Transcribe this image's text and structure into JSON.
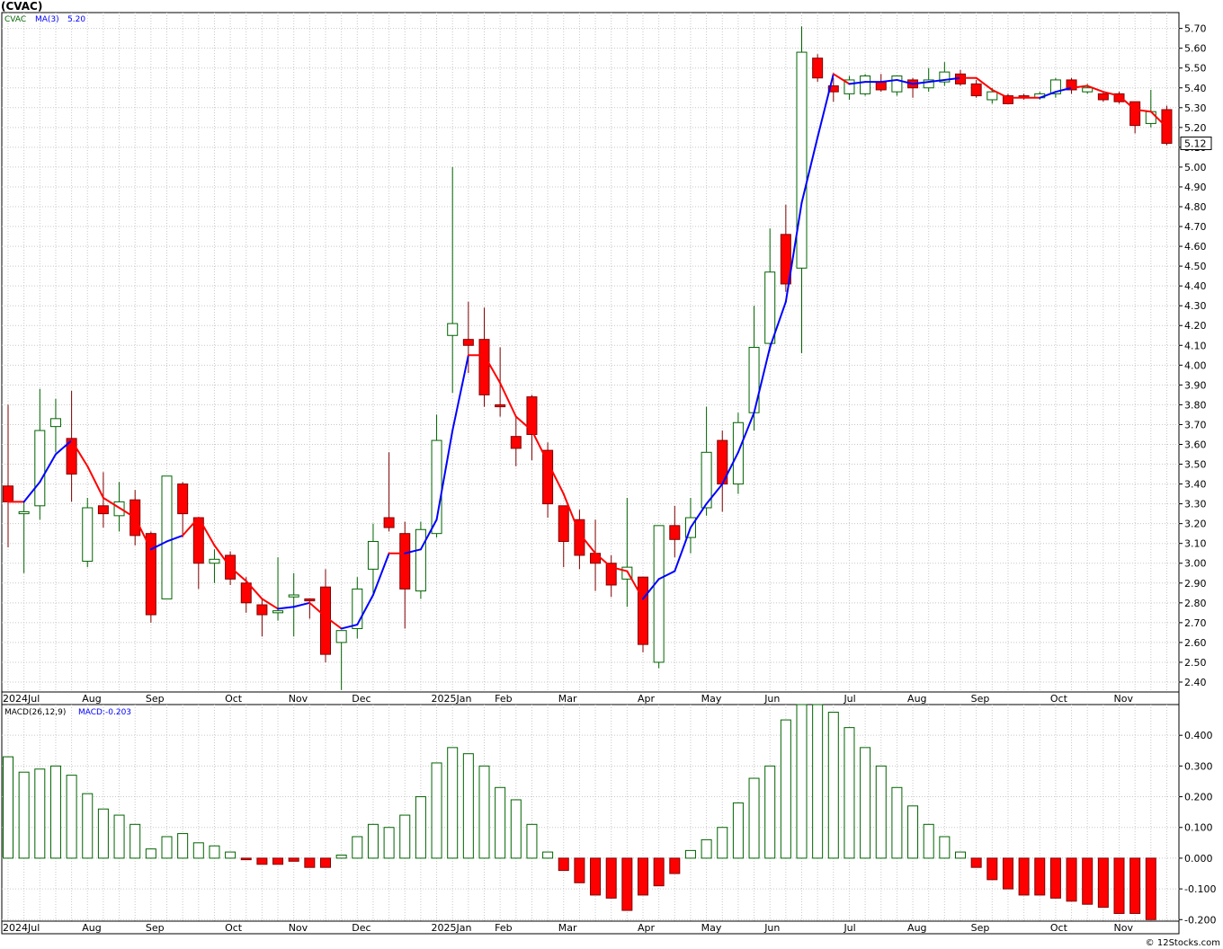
{
  "chart_data": [
    {
      "type": "candlestick",
      "title": "(CVAC)",
      "legend": {
        "symbol": "CVAC",
        "ma_label": "MA(3)",
        "ma_value": "5.20"
      },
      "last_price_tag": "5.12",
      "ylim": [
        2.35,
        5.78
      ],
      "y_ticks": [
        "5.70",
        "5.60",
        "5.50",
        "5.40",
        "5.30",
        "5.20",
        "5.10",
        "5.00",
        "4.90",
        "4.80",
        "4.70",
        "4.60",
        "4.50",
        "4.40",
        "4.30",
        "4.20",
        "4.10",
        "4.00",
        "3.90",
        "3.80",
        "3.70",
        "3.60",
        "3.50",
        "3.40",
        "3.30",
        "3.20",
        "3.10",
        "3.00",
        "2.90",
        "2.80",
        "2.70",
        "2.60",
        "2.50",
        "2.40"
      ],
      "x_labels": [
        {
          "label": "2024Jul",
          "index": 0
        },
        {
          "label": "Aug",
          "index": 5
        },
        {
          "label": "Sep",
          "index": 9
        },
        {
          "label": "Oct",
          "index": 14
        },
        {
          "label": "Nov",
          "index": 18
        },
        {
          "label": "Dec",
          "index": 22
        },
        {
          "label": "2025Jan",
          "index": 27
        },
        {
          "label": "Feb",
          "index": 31
        },
        {
          "label": "Mar",
          "index": 35
        },
        {
          "label": "Apr",
          "index": 40
        },
        {
          "label": "May",
          "index": 44
        },
        {
          "label": "Jun",
          "index": 48
        },
        {
          "label": "Jul",
          "index": 53
        },
        {
          "label": "Aug",
          "index": 57
        },
        {
          "label": "Sep",
          "index": 61
        },
        {
          "label": "Oct",
          "index": 66
        },
        {
          "label": "Nov",
          "index": 70
        }
      ],
      "candles": [
        {
          "o": 3.39,
          "h": 3.8,
          "l": 3.08,
          "c": 3.31
        },
        {
          "o": 3.25,
          "h": 3.31,
          "l": 2.95,
          "c": 3.26
        },
        {
          "o": 3.29,
          "h": 3.88,
          "l": 3.22,
          "c": 3.67
        },
        {
          "o": 3.69,
          "h": 3.83,
          "l": 3.56,
          "c": 3.73
        },
        {
          "o": 3.63,
          "h": 3.87,
          "l": 3.31,
          "c": 3.45
        },
        {
          "o": 3.01,
          "h": 3.33,
          "l": 2.98,
          "c": 3.28
        },
        {
          "o": 3.29,
          "h": 3.46,
          "l": 3.18,
          "c": 3.25
        },
        {
          "o": 3.24,
          "h": 3.41,
          "l": 3.16,
          "c": 3.31
        },
        {
          "o": 3.32,
          "h": 3.37,
          "l": 3.09,
          "c": 3.14
        },
        {
          "o": 3.15,
          "h": 3.16,
          "l": 2.7,
          "c": 2.74
        },
        {
          "o": 2.82,
          "h": 3.44,
          "l": 2.82,
          "c": 3.44
        },
        {
          "o": 3.4,
          "h": 3.41,
          "l": 3.13,
          "c": 3.25
        },
        {
          "o": 3.23,
          "h": 3.23,
          "l": 2.87,
          "c": 3.0
        },
        {
          "o": 3.0,
          "h": 3.07,
          "l": 2.9,
          "c": 3.02
        },
        {
          "o": 3.04,
          "h": 3.06,
          "l": 2.89,
          "c": 2.92
        },
        {
          "o": 2.9,
          "h": 2.93,
          "l": 2.75,
          "c": 2.8
        },
        {
          "o": 2.79,
          "h": 2.82,
          "l": 2.63,
          "c": 2.74
        },
        {
          "o": 2.75,
          "h": 3.03,
          "l": 2.71,
          "c": 2.76
        },
        {
          "o": 2.83,
          "h": 2.95,
          "l": 2.63,
          "c": 2.84
        },
        {
          "o": 2.82,
          "h": 2.82,
          "l": 2.72,
          "c": 2.81
        },
        {
          "o": 2.88,
          "h": 2.97,
          "l": 2.5,
          "c": 2.54
        },
        {
          "o": 2.6,
          "h": 2.65,
          "l": 2.36,
          "c": 2.66
        },
        {
          "o": 2.67,
          "h": 2.93,
          "l": 2.62,
          "c": 2.87
        },
        {
          "o": 2.97,
          "h": 3.2,
          "l": 2.85,
          "c": 3.11
        },
        {
          "o": 3.23,
          "h": 3.56,
          "l": 3.16,
          "c": 3.18
        },
        {
          "o": 3.15,
          "h": 3.21,
          "l": 2.67,
          "c": 2.87
        },
        {
          "o": 2.86,
          "h": 3.21,
          "l": 2.82,
          "c": 3.17
        },
        {
          "o": 3.15,
          "h": 3.75,
          "l": 3.13,
          "c": 3.62
        },
        {
          "o": 4.15,
          "h": 5.0,
          "l": 3.86,
          "c": 4.21
        },
        {
          "o": 4.13,
          "h": 4.32,
          "l": 3.96,
          "c": 4.1
        },
        {
          "o": 4.13,
          "h": 4.29,
          "l": 3.79,
          "c": 3.85
        },
        {
          "o": 3.8,
          "h": 4.09,
          "l": 3.74,
          "c": 3.79
        },
        {
          "o": 3.64,
          "h": 3.74,
          "l": 3.49,
          "c": 3.58
        },
        {
          "o": 3.84,
          "h": 3.85,
          "l": 3.52,
          "c": 3.65
        },
        {
          "o": 3.57,
          "h": 3.61,
          "l": 3.23,
          "c": 3.3
        },
        {
          "o": 3.29,
          "h": 3.28,
          "l": 2.98,
          "c": 3.11
        },
        {
          "o": 3.22,
          "h": 3.27,
          "l": 2.97,
          "c": 3.04
        },
        {
          "o": 3.05,
          "h": 3.22,
          "l": 2.86,
          "c": 3.0
        },
        {
          "o": 3.0,
          "h": 3.04,
          "l": 2.83,
          "c": 2.89
        },
        {
          "o": 2.92,
          "h": 3.33,
          "l": 2.78,
          "c": 2.98
        },
        {
          "o": 2.93,
          "h": 2.93,
          "l": 2.55,
          "c": 2.59
        },
        {
          "o": 2.5,
          "h": 3.19,
          "l": 2.47,
          "c": 3.19
        },
        {
          "o": 3.19,
          "h": 3.29,
          "l": 3.03,
          "c": 3.12
        },
        {
          "o": 3.13,
          "h": 3.33,
          "l": 3.05,
          "c": 3.23
        },
        {
          "o": 3.28,
          "h": 3.79,
          "l": 3.24,
          "c": 3.56
        },
        {
          "o": 3.62,
          "h": 3.67,
          "l": 3.26,
          "c": 3.4
        },
        {
          "o": 3.4,
          "h": 3.76,
          "l": 3.35,
          "c": 3.71
        },
        {
          "o": 3.76,
          "h": 4.3,
          "l": 3.67,
          "c": 4.09
        },
        {
          "o": 4.11,
          "h": 4.69,
          "l": 4.07,
          "c": 4.47
        },
        {
          "o": 4.66,
          "h": 4.81,
          "l": 4.37,
          "c": 4.41
        },
        {
          "o": 4.49,
          "h": 5.71,
          "l": 4.06,
          "c": 5.58
        },
        {
          "o": 5.55,
          "h": 5.57,
          "l": 5.43,
          "c": 5.45
        },
        {
          "o": 5.41,
          "h": 5.45,
          "l": 5.33,
          "c": 5.38
        },
        {
          "o": 5.37,
          "h": 5.46,
          "l": 5.34,
          "c": 5.44
        },
        {
          "o": 5.37,
          "h": 5.47,
          "l": 5.36,
          "c": 5.46
        },
        {
          "o": 5.43,
          "h": 5.47,
          "l": 5.38,
          "c": 5.39
        },
        {
          "o": 5.38,
          "h": 5.46,
          "l": 5.36,
          "c": 5.46
        },
        {
          "o": 5.44,
          "h": 5.45,
          "l": 5.35,
          "c": 5.4
        },
        {
          "o": 5.4,
          "h": 5.5,
          "l": 5.38,
          "c": 5.44
        },
        {
          "o": 5.43,
          "h": 5.53,
          "l": 5.41,
          "c": 5.48
        },
        {
          "o": 5.47,
          "h": 5.49,
          "l": 5.41,
          "c": 5.42
        },
        {
          "o": 5.42,
          "h": 5.44,
          "l": 5.35,
          "c": 5.36
        },
        {
          "o": 5.34,
          "h": 5.4,
          "l": 5.32,
          "c": 5.38
        },
        {
          "o": 5.36,
          "h": 5.37,
          "l": 5.32,
          "c": 5.32
        },
        {
          "o": 5.36,
          "h": 5.37,
          "l": 5.34,
          "c": 5.35
        },
        {
          "o": 5.35,
          "h": 5.38,
          "l": 5.34,
          "c": 5.37
        },
        {
          "o": 5.37,
          "h": 5.45,
          "l": 5.35,
          "c": 5.44
        },
        {
          "o": 5.44,
          "h": 5.45,
          "l": 5.37,
          "c": 5.39
        },
        {
          "o": 5.38,
          "h": 5.42,
          "l": 5.37,
          "c": 5.4
        },
        {
          "o": 5.37,
          "h": 5.38,
          "l": 5.33,
          "c": 5.34
        },
        {
          "o": 5.37,
          "h": 5.38,
          "l": 5.32,
          "c": 5.33
        },
        {
          "o": 5.33,
          "h": 5.33,
          "l": 5.17,
          "c": 5.21
        },
        {
          "o": 5.22,
          "h": 5.39,
          "l": 5.2,
          "c": 5.28
        },
        {
          "o": 5.29,
          "h": 5.31,
          "l": 5.11,
          "c": 5.12
        }
      ],
      "ma": [
        3.31,
        3.31,
        3.41,
        3.55,
        3.62,
        3.49,
        3.33,
        3.28,
        3.23,
        3.07,
        3.11,
        3.14,
        3.23,
        3.09,
        2.98,
        2.91,
        2.82,
        2.77,
        2.78,
        2.8,
        2.73,
        2.67,
        2.69,
        2.84,
        3.05,
        3.05,
        3.07,
        3.22,
        3.67,
        4.05,
        4.05,
        3.91,
        3.74,
        3.67,
        3.51,
        3.35,
        3.15,
        3.05,
        2.98,
        2.96,
        2.82,
        2.92,
        2.96,
        3.18,
        3.3,
        3.4,
        3.56,
        3.76,
        4.09,
        4.32,
        4.82,
        5.15,
        5.47,
        5.42,
        5.43,
        5.43,
        5.44,
        5.42,
        5.43,
        5.44,
        5.45,
        5.45,
        5.39,
        5.35,
        5.35,
        5.35,
        5.38,
        5.4,
        5.41,
        5.38,
        5.36,
        5.29,
        5.28,
        5.2
      ],
      "ma_colors": [
        "red",
        "red",
        "blue",
        "blue",
        "blue",
        "red",
        "red",
        "red",
        "red",
        "red",
        "blue",
        "blue",
        "red",
        "red",
        "red",
        "red",
        "red",
        "red",
        "blue",
        "blue",
        "red",
        "red",
        "blue",
        "blue",
        "blue",
        "red",
        "blue",
        "blue",
        "blue",
        "blue",
        "red",
        "red",
        "red",
        "red",
        "red",
        "red",
        "red",
        "red",
        "red",
        "red",
        "red",
        "blue",
        "blue",
        "blue",
        "blue",
        "blue",
        "blue",
        "blue",
        "blue",
        "blue",
        "blue",
        "blue",
        "blue",
        "red",
        "blue",
        "blue",
        "blue",
        "blue",
        "blue",
        "blue",
        "blue",
        "red",
        "red",
        "red",
        "red",
        "red",
        "blue",
        "blue",
        "red",
        "red",
        "red",
        "red",
        "red",
        "red"
      ]
    },
    {
      "type": "bar",
      "title": "MACD(26,12,9)",
      "legend": {
        "label": "MACD(26,12,9)",
        "value_label": "MACD:-0.203"
      },
      "ylim": [
        -0.205,
        0.5
      ],
      "y_ticks": [
        "0.400",
        "0.300",
        "0.200",
        "0.100",
        "0.000",
        "-0.100",
        "-0.200"
      ],
      "values": [
        0.33,
        0.28,
        0.29,
        0.3,
        0.27,
        0.21,
        0.16,
        0.14,
        0.11,
        0.03,
        0.07,
        0.08,
        0.05,
        0.04,
        0.02,
        -0.005,
        -0.02,
        -0.02,
        -0.01,
        -0.03,
        -0.03,
        0.01,
        0.07,
        0.11,
        0.1,
        0.14,
        0.2,
        0.31,
        0.36,
        0.34,
        0.3,
        0.23,
        0.19,
        0.11,
        0.02,
        -0.04,
        -0.08,
        -0.12,
        -0.13,
        -0.17,
        -0.12,
        -0.09,
        -0.05,
        0.025,
        0.06,
        0.1,
        0.18,
        0.26,
        0.3,
        0.45,
        0.5,
        0.5,
        0.475,
        0.425,
        0.36,
        0.3,
        0.23,
        0.17,
        0.11,
        0.07,
        0.02,
        -0.03,
        -0.07,
        -0.1,
        -0.12,
        -0.12,
        -0.13,
        -0.14,
        -0.15,
        -0.16,
        -0.18,
        -0.18,
        -0.2
      ],
      "x_labels": [
        "2024Jul",
        "Aug",
        "Sep",
        "Oct",
        "Nov",
        "Dec",
        "2025Jan",
        "Feb",
        "Mar",
        "Apr",
        "May",
        "Jun",
        "Jul",
        "Aug",
        "Sep",
        "Oct",
        "Nov"
      ]
    }
  ],
  "footer": {
    "source": "© 12Stocks.com"
  },
  "colors": {
    "up_fill": "#ffffff",
    "up_stroke": "#006400",
    "down_fill": "#ff0000",
    "down_stroke": "#800000",
    "ma_up": "#0000ff",
    "ma_down": "#ff0000",
    "grid": "#c8c8c8",
    "macd_pos_stroke": "#006400",
    "macd_neg_fill": "#ff0000"
  }
}
